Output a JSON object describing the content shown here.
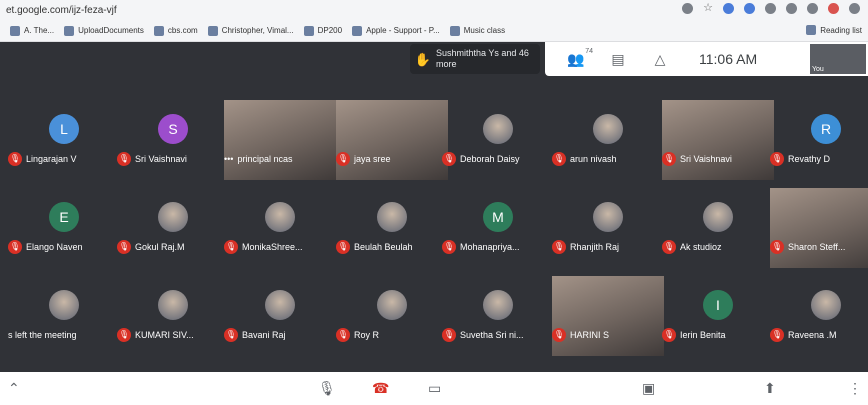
{
  "browser": {
    "url": "et.google.com/ijz-feza-vjf",
    "bookmarks": [
      "A. The...",
      "UploadDocuments",
      "cbs.com",
      "Christopher, Vimal...",
      "DP200",
      "Apple - Support - P...",
      "Music class"
    ],
    "reading_list": "Reading list"
  },
  "meet": {
    "raised_hands": "Sushmiththa Ys and 46 more",
    "participant_count": "74",
    "time": "11:06 AM",
    "self_label": "You",
    "participants": [
      {
        "name": "Lingarajan V",
        "initial": "L",
        "color": "#4a90d9",
        "kind": "initial",
        "mic": "off"
      },
      {
        "name": "Sri Vaishnavi",
        "initial": "S",
        "color": "#9c4dcc",
        "kind": "initial",
        "mic": "off"
      },
      {
        "name": "principal ncas",
        "initial": "",
        "color": "",
        "kind": "video",
        "mic": "on"
      },
      {
        "name": "jaya sree",
        "initial": "",
        "color": "",
        "kind": "video",
        "mic": "off"
      },
      {
        "name": "Deborah Daisy",
        "initial": "",
        "color": "",
        "kind": "photo",
        "mic": "off"
      },
      {
        "name": "arun nivash",
        "initial": "",
        "color": "",
        "kind": "photo",
        "mic": "off"
      },
      {
        "name": "Sri Vaishnavi",
        "initial": "",
        "color": "",
        "kind": "video",
        "mic": "off"
      },
      {
        "name": "Revathy D",
        "initial": "R",
        "color": "#3d8fd6",
        "kind": "initial",
        "mic": "off"
      },
      {
        "name": "Elango Naven",
        "initial": "E",
        "color": "#2e7d5b",
        "kind": "initial",
        "mic": "off"
      },
      {
        "name": "Gokul Raj.M",
        "initial": "",
        "color": "",
        "kind": "photo",
        "mic": "off"
      },
      {
        "name": "MonikaShree...",
        "initial": "",
        "color": "",
        "kind": "photo",
        "mic": "off"
      },
      {
        "name": "Beulah Beulah",
        "initial": "",
        "color": "",
        "kind": "photo",
        "mic": "off"
      },
      {
        "name": "Mohanapriya...",
        "initial": "M",
        "color": "#2e7d5b",
        "kind": "initial",
        "mic": "off"
      },
      {
        "name": "Rhanjith Raj",
        "initial": "",
        "color": "",
        "kind": "photo",
        "mic": "off"
      },
      {
        "name": "Ak studioz",
        "initial": "",
        "color": "",
        "kind": "photo",
        "mic": "off"
      },
      {
        "name": "Sharon Steff...",
        "initial": "",
        "color": "",
        "kind": "video",
        "mic": "off"
      },
      {
        "name": "s left the meeting",
        "initial": "",
        "color": "",
        "kind": "photo",
        "mic": "none"
      },
      {
        "name": "KUMARI SIV...",
        "initial": "",
        "color": "",
        "kind": "photo",
        "mic": "off"
      },
      {
        "name": "Bavani Raj",
        "initial": "",
        "color": "",
        "kind": "photo",
        "mic": "off"
      },
      {
        "name": "Roy R",
        "initial": "",
        "color": "",
        "kind": "photo",
        "mic": "off"
      },
      {
        "name": "Suvetha Sri ni...",
        "initial": "",
        "color": "",
        "kind": "photo",
        "mic": "off"
      },
      {
        "name": "HARINI S",
        "initial": "",
        "color": "",
        "kind": "video",
        "mic": "off"
      },
      {
        "name": "Ierin Benita",
        "initial": "I",
        "color": "#2e7d5b",
        "kind": "initial",
        "mic": "off"
      },
      {
        "name": "Raveena .M",
        "initial": "",
        "color": "",
        "kind": "photo",
        "mic": "off"
      }
    ]
  }
}
